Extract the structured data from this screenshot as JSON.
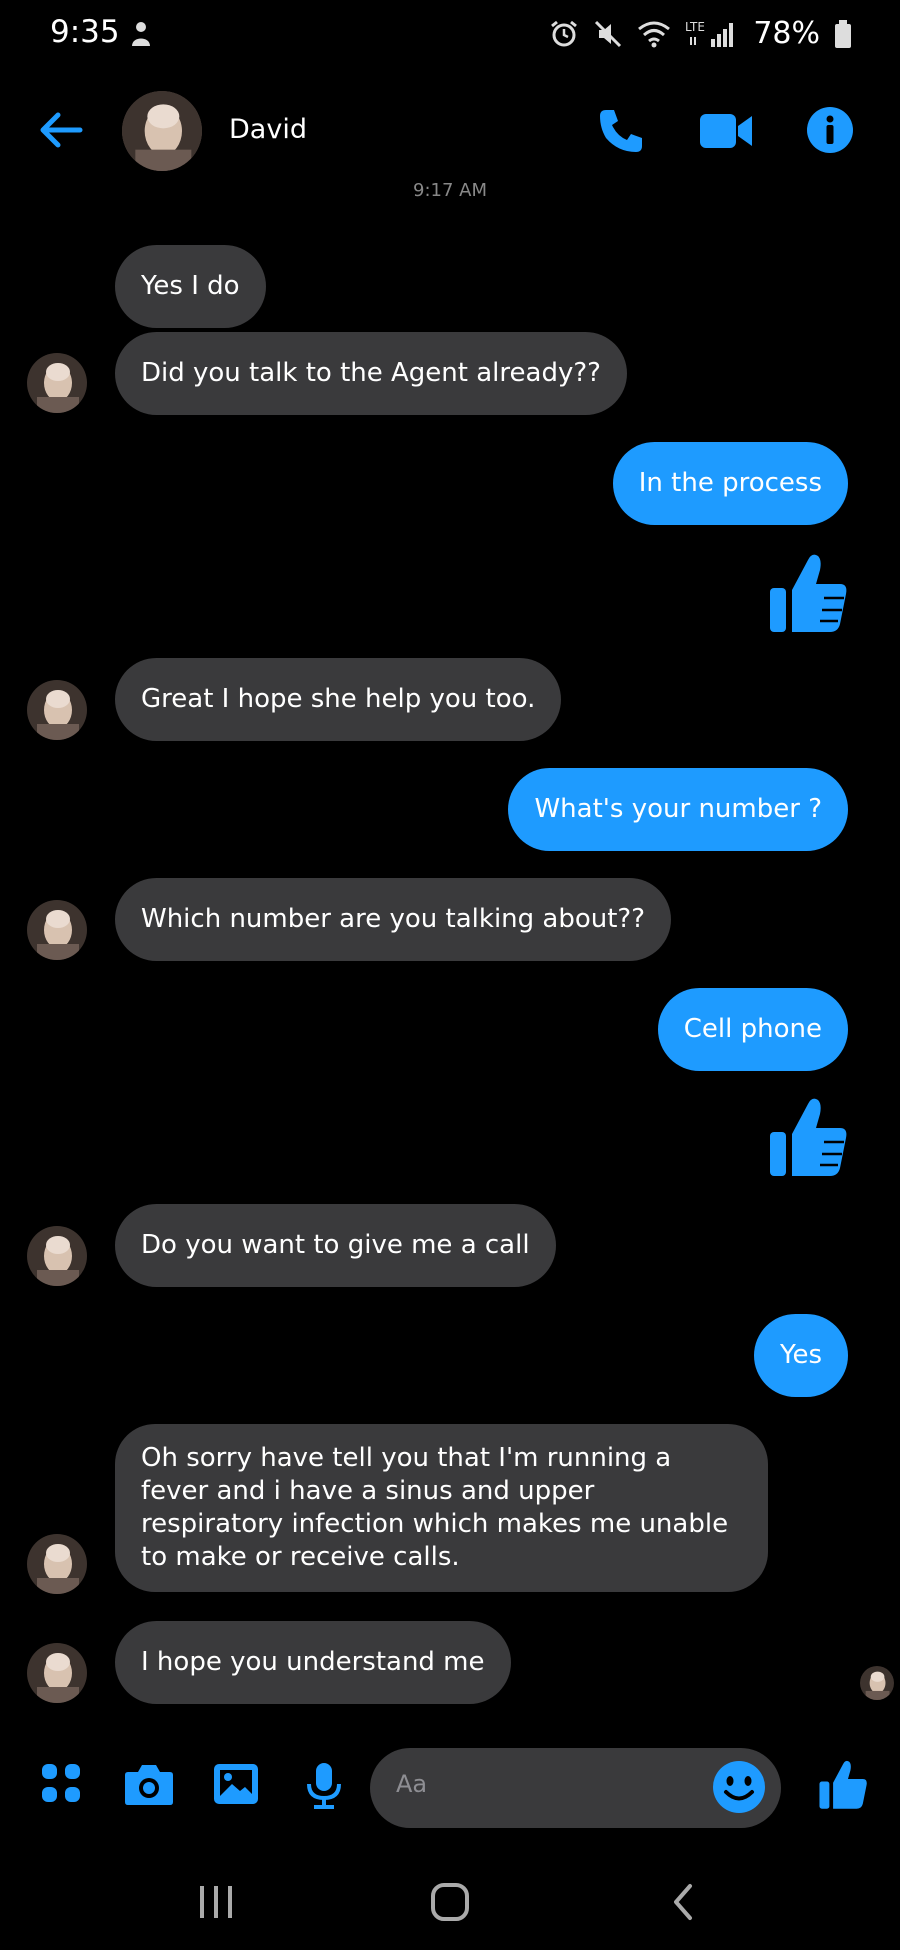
{
  "status": {
    "time": "9:35",
    "battery": "78%"
  },
  "header": {
    "contact_name": "David"
  },
  "timestamp": "9:17 AM",
  "messages": [
    {
      "from": "them",
      "text": "Yes I do"
    },
    {
      "from": "them",
      "text": "Did you talk to the Agent already??"
    },
    {
      "from": "me",
      "text": "In the process"
    },
    {
      "from": "me",
      "type": "like"
    },
    {
      "from": "them",
      "text": "Great I hope she help you too."
    },
    {
      "from": "me",
      "text": "What's your number ?"
    },
    {
      "from": "them",
      "text": "Which number are you talking about??"
    },
    {
      "from": "me",
      "text": "Cell phone"
    },
    {
      "from": "me",
      "type": "like"
    },
    {
      "from": "them",
      "text": "Do you want to give me a call"
    },
    {
      "from": "me",
      "text": "Yes"
    },
    {
      "from": "them",
      "text": "Oh sorry have tell you that I'm running a fever and i have a sinus and upper respiratory infection which makes me unable to make or receive calls."
    },
    {
      "from": "them",
      "text": "I hope you understand me"
    }
  ],
  "composer": {
    "placeholder": "Aa"
  },
  "colors": {
    "accent": "#1e9bff",
    "incoming_bubble": "#3a3a3c",
    "background": "#000000"
  }
}
